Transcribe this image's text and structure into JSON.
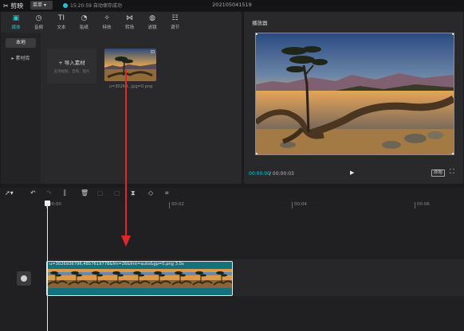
{
  "app": {
    "name": "剪映",
    "menu_label": "菜单",
    "save_status": "15:20:59 自动保存成功",
    "project_title": "202105041519"
  },
  "media_toolbar": [
    {
      "label": "媒体",
      "icon": "▣",
      "active": true
    },
    {
      "label": "音频",
      "icon": "◷",
      "active": false
    },
    {
      "label": "文本",
      "icon": "TI",
      "active": false
    },
    {
      "label": "贴纸",
      "icon": "◔",
      "active": false
    },
    {
      "label": "特效",
      "icon": "✧",
      "active": false
    },
    {
      "label": "转场",
      "icon": "⋈",
      "active": false
    },
    {
      "label": "滤镜",
      "icon": "◍",
      "active": false
    },
    {
      "label": "调节",
      "icon": "☷",
      "active": false
    }
  ],
  "sidebar": {
    "local": "本地",
    "library": "▸ 素材库"
  },
  "import": {
    "label": "+ 导入素材",
    "hint": "支持视频、音频、图片"
  },
  "media_item": {
    "name": "u=30269...jpg=0.png"
  },
  "player": {
    "title": "播放器",
    "time_current": "00:00:00",
    "time_total": "/ 00:00:03",
    "ratio_label": "原始",
    "play_icon": "▶",
    "fullscreen_icon": "⛶"
  },
  "ruler": {
    "ticks": [
      "00:00",
      "00:02",
      "00:04",
      "00:06"
    ]
  },
  "clip": {
    "label": "u=3026936796,4857619778&fm=26&fmt=auto&gp=0.png   3.0s"
  },
  "colors": {
    "accent": "#21c4d3",
    "clip_bg": "#15707a",
    "arrow": "#e0262b"
  }
}
